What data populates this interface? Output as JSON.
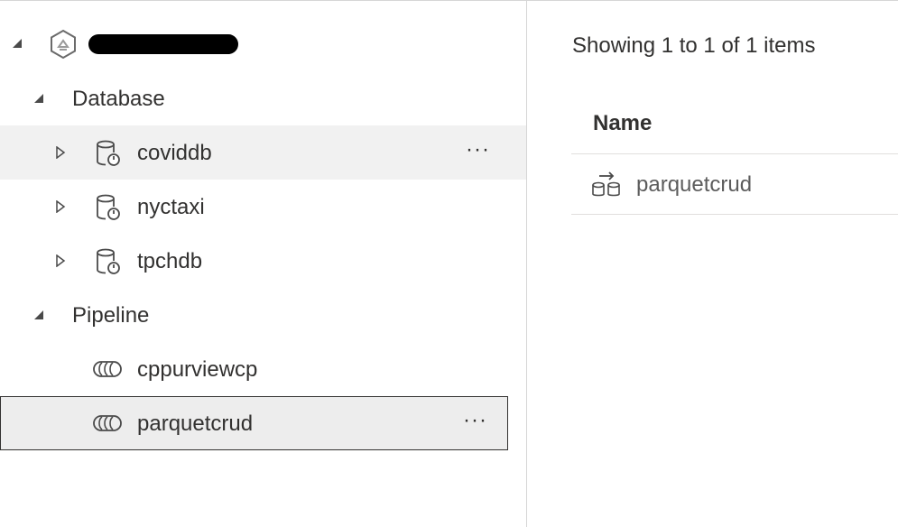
{
  "tree": {
    "root": {
      "label_redacted": true,
      "icon": "workspace-hexagon-icon"
    },
    "sections": [
      {
        "label": "Database",
        "expanded": true,
        "items": [
          {
            "label": "coviddb",
            "icon": "database-icon",
            "state": "hover",
            "more": "···"
          },
          {
            "label": "nyctaxi",
            "icon": "database-icon"
          },
          {
            "label": "tpchdb",
            "icon": "database-icon"
          }
        ]
      },
      {
        "label": "Pipeline",
        "expanded": true,
        "items": [
          {
            "label": "cppurviewcp",
            "icon": "pipeline-icon"
          },
          {
            "label": "parquetcrud",
            "icon": "pipeline-icon",
            "state": "selected",
            "more": "···"
          }
        ]
      }
    ]
  },
  "list": {
    "summary": "Showing 1 to 1 of 1 items",
    "columns": [
      "Name"
    ],
    "rows": [
      {
        "name": "parquetcrud",
        "icon": "copy-data-icon"
      }
    ]
  },
  "colors": {
    "text": "#323130",
    "hover_bg": "#f1f1f1",
    "selected_bg": "#ededed",
    "divider": "#d6d6d6"
  }
}
